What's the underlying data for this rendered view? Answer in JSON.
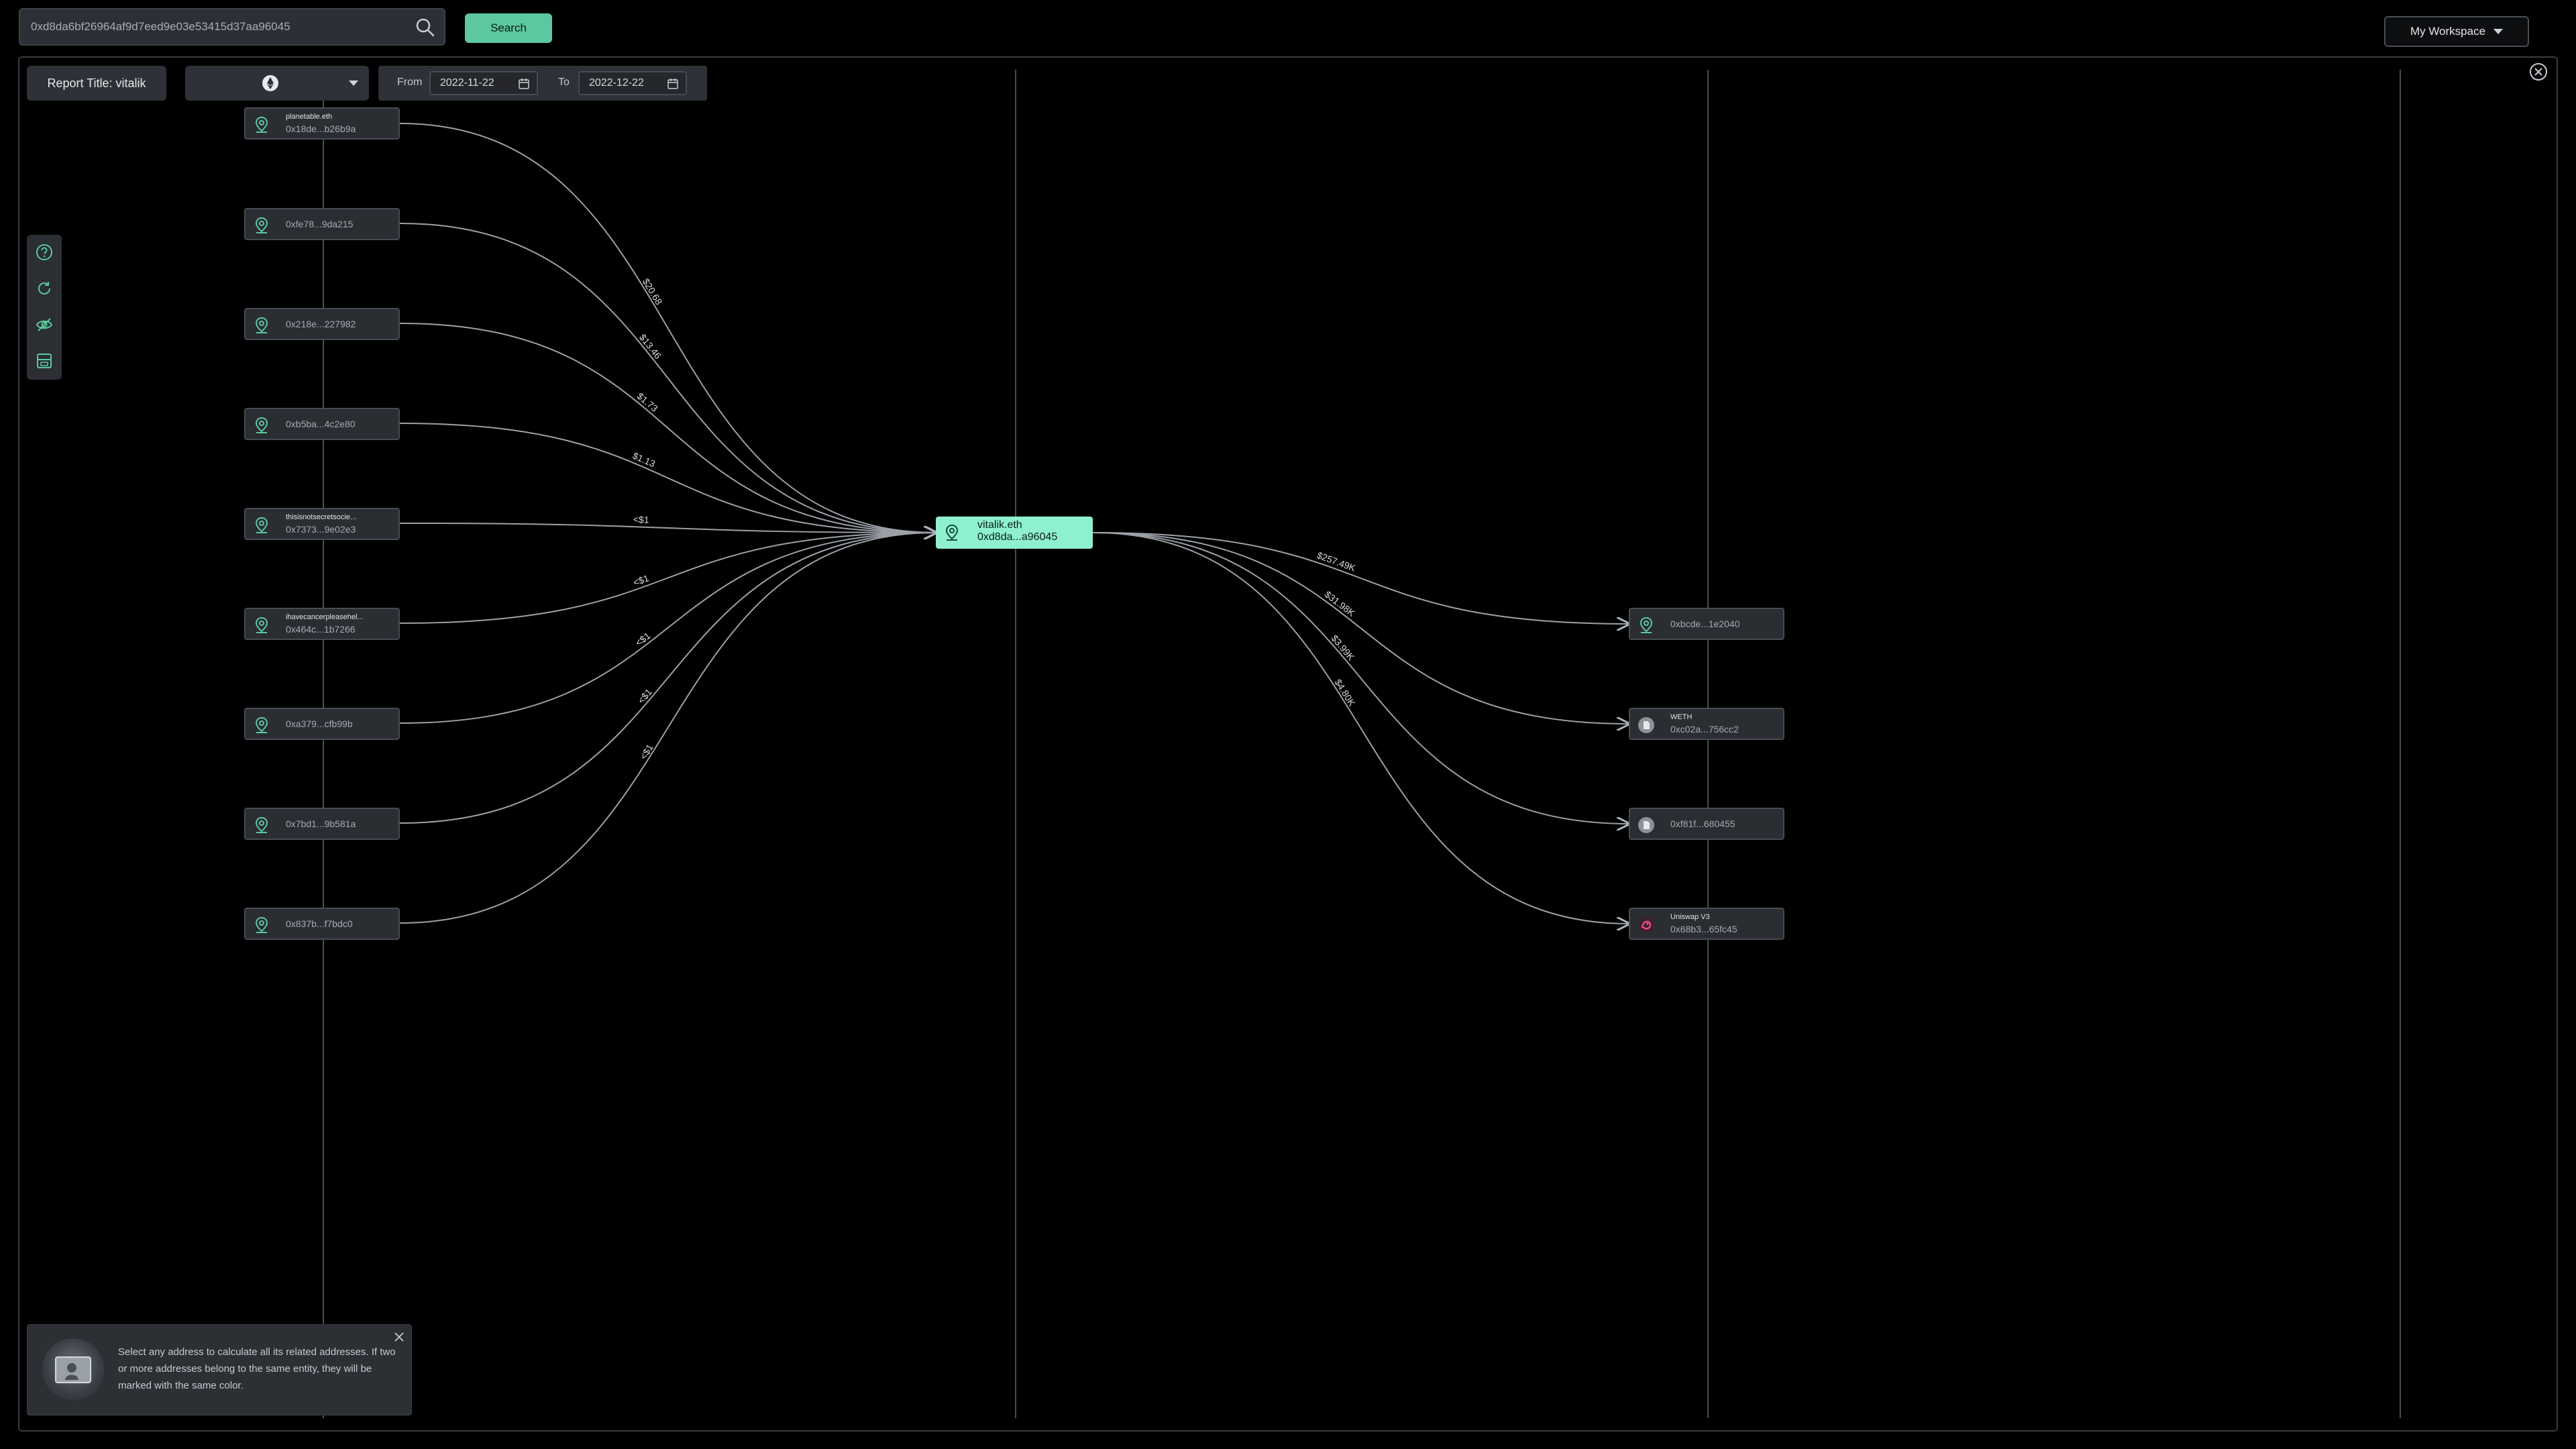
{
  "search": {
    "value": "0xd8da6bf26964af9d7eed9e03e53415d37aa96045",
    "button_label": "Search"
  },
  "workspace": {
    "label": "My Workspace"
  },
  "report": {
    "title": "Report Title: vitalik"
  },
  "date_range": {
    "from_label": "From",
    "from_value": "2022-11-22",
    "to_label": "To",
    "to_value": "2022-12-22"
  },
  "center": {
    "name": "vitalik.eth",
    "address": "0xd8da...a96045"
  },
  "left_nodes": [
    {
      "name": "planetable.eth",
      "address": "0x18de...b26b9a",
      "edge": "$20.68"
    },
    {
      "name": "",
      "address": "0xfe78...9da215",
      "edge": "$13.46"
    },
    {
      "name": "",
      "address": "0x218e...227982",
      "edge": "$1.73"
    },
    {
      "name": "",
      "address": "0xb5ba...4c2e80",
      "edge": "$1.13"
    },
    {
      "name": "thisisnotsecretsocie...",
      "address": "0x7373...9e02e3",
      "edge": "<$1"
    },
    {
      "name": "ihavecancerpleasehel...",
      "address": "0x464c...1b7266",
      "edge": "<$1"
    },
    {
      "name": "",
      "address": "0xa379...cfb99b",
      "edge": "<$1"
    },
    {
      "name": "",
      "address": "0x7bd1...9b581a",
      "edge": "<$1"
    },
    {
      "name": "",
      "address": "0x837b...f7bdc0",
      "edge": "<$1"
    }
  ],
  "right_nodes": [
    {
      "name": "",
      "address": "0xbcde...1e2040",
      "edge": "$257.49K",
      "icon": "wallet-icon"
    },
    {
      "name": "WETH",
      "address": "0xc02a...756cc2",
      "edge": "$31.98K",
      "icon": "token-icon"
    },
    {
      "name": "",
      "address": "0xf81f...680455",
      "edge": "$3.99K",
      "icon": "token-icon"
    },
    {
      "name": "Uniswap V3",
      "address": "0x68b3...65fc45",
      "edge": "$4.80K",
      "icon": "uniswap-icon"
    }
  ],
  "hint": {
    "text": "Select any address to calculate all its related addresses. If two or more addresses belong to the same entity, they will be marked with the same color."
  },
  "colors": {
    "accent": "#5dc8a0",
    "center_node": "#8ef0cf",
    "background": "#000000",
    "node_bg": "#2a2d32"
  }
}
